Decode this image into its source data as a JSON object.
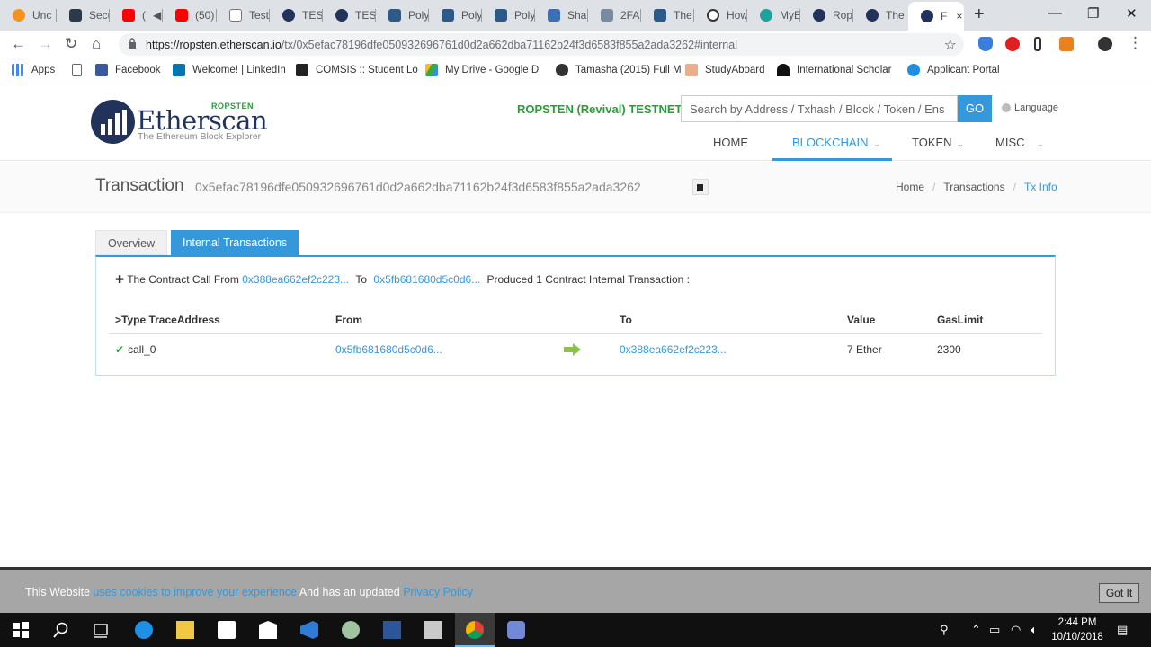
{
  "browser": {
    "tabs": [
      {
        "label": "Unc",
        "icon": "bitcoin-icon",
        "color": "#f7931a"
      },
      {
        "label": "Secu",
        "icon": "page-icon",
        "color": "#2b3a4a"
      },
      {
        "label": "(",
        "icon": "youtube-icon",
        "color": "#ff0000"
      },
      {
        "label": "(50)",
        "icon": "youtube-icon",
        "color": "#ff0000"
      },
      {
        "label": "Test",
        "icon": "document-icon",
        "color": "#777777"
      },
      {
        "label": "TEST",
        "icon": "etherscan-icon",
        "color": "#21325b"
      },
      {
        "label": "TEST",
        "icon": "etherscan-icon",
        "color": "#21325b"
      },
      {
        "label": "Poly",
        "icon": "poly-icon",
        "color": "#2b5a8a"
      },
      {
        "label": "Poly",
        "icon": "poly-icon",
        "color": "#2b5a8a"
      },
      {
        "label": "Poly",
        "icon": "poly-icon",
        "color": "#2b5a8a"
      },
      {
        "label": "Shap",
        "icon": "shap-icon",
        "color": "#3b6fb6"
      },
      {
        "label": "2FA",
        "icon": "metamask-icon",
        "color": "#7a8aa0"
      },
      {
        "label": "The",
        "icon": "poly-icon",
        "color": "#2b5a8a"
      },
      {
        "label": "How",
        "icon": "how-icon",
        "color": "#333333"
      },
      {
        "label": "MyE",
        "icon": "myether-icon",
        "color": "#1ba39c"
      },
      {
        "label": "Rop",
        "icon": "etherscan-icon",
        "color": "#21325b"
      },
      {
        "label": "The",
        "icon": "etherscan-icon",
        "color": "#21325b"
      },
      {
        "label": "F",
        "icon": "etherscan-icon",
        "color": "#21325b"
      }
    ],
    "close_tab": "×",
    "new_tab": "+",
    "url_host": "https://ropsten.etherscan.io",
    "url_path": "/tx/0x5efac78196dfe050932696761d0d2a662dba71162b24f3d6583f855a2ada3262#internal",
    "bookmarks": [
      {
        "label": "Apps",
        "icon": "apps-icon",
        "color": "#4285f4"
      },
      {
        "label": "",
        "icon": "page-icon",
        "color": "#ffffff"
      },
      {
        "label": "Facebook",
        "icon": "facebook-icon",
        "color": "#3b5998"
      },
      {
        "label": "Welcome! | LinkedIn",
        "icon": "linkedin-icon",
        "color": "#0077b5"
      },
      {
        "label": "COMSIS :: Student Lo",
        "icon": "comsis-icon",
        "color": "#222222"
      },
      {
        "label": "My Drive - Google D",
        "icon": "drive-icon",
        "color": "#fbbc05"
      },
      {
        "label": "Tamasha (2015) Full M",
        "icon": "film-icon",
        "color": "#333333"
      },
      {
        "label": "StudyAboard",
        "icon": "study-icon",
        "color": "#e8b08a"
      },
      {
        "label": "International Scholar",
        "icon": "trophy-icon",
        "color": "#111111"
      },
      {
        "label": "Applicant Portal",
        "icon": "cloud-icon",
        "color": "#1f8fe5"
      }
    ]
  },
  "site": {
    "logo_ropsten": "ROPSTEN",
    "logo_name": "Etherscan",
    "logo_tagline": "The Ethereum Block Explorer",
    "network_label": "ROPSTEN (Revival) TESTNET",
    "search_placeholder": "Search by Address / Txhash / Block / Token / Ens",
    "go_label": "GO",
    "language_label": "Language",
    "menu": {
      "home": "HOME",
      "blockchain": "BLOCKCHAIN",
      "token": "TOKEN",
      "misc": "MISC"
    }
  },
  "page": {
    "title": "Transaction",
    "tx_hash": "0x5efac78196dfe050932696761d0d2a662dba71162b24f3d6583f855a2ada3262",
    "breadcrumb": [
      "Home",
      "Transactions",
      "Tx Info"
    ],
    "tabs": [
      "Overview",
      "Internal Transactions"
    ],
    "desc": {
      "prefix": "The Contract Call",
      "from_label": "From",
      "from_addr": "0x388ea662ef2c223...",
      "to_label": "To",
      "to_addr": "0x5fb681680d5c0d6...",
      "suffix": "Produced 1 Contract Internal Transaction :"
    },
    "table": {
      "headers": [
        ">Type TraceAddress",
        "From",
        "To",
        "Value",
        "GasLimit"
      ],
      "rows": [
        {
          "type": "call_0",
          "from": "0x5fb681680d5c0d6...",
          "to": "0x388ea662ef2c223...",
          "value": "7 Ether",
          "gaslimit": "2300"
        }
      ]
    }
  },
  "cookie": {
    "text1": "This Website",
    "link1": "uses cookies to improve your experience",
    "text2": "And has an updated",
    "link2": "Privacy Policy",
    "button": "Got It"
  },
  "taskbar": {
    "time": "2:44 PM",
    "date": "10/10/2018"
  },
  "colors": {
    "accent": "#3498db",
    "testnet_green": "#2a9d3b",
    "brand_navy": "#21325b"
  }
}
